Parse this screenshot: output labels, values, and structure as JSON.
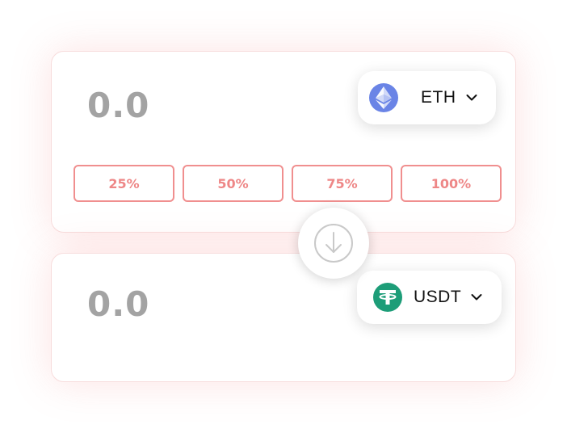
{
  "from": {
    "amount": "0.0",
    "token": {
      "symbol": "ETH",
      "icon": "ethereum-icon",
      "color": "#6a84e6"
    },
    "percent_buttons": [
      "25%",
      "50%",
      "75%",
      "100%"
    ]
  },
  "swap": {
    "icon": "arrow-down-icon"
  },
  "to": {
    "amount": "0.0",
    "token": {
      "symbol": "USDT",
      "icon": "tether-icon",
      "color": "#1d9d78"
    }
  },
  "colors": {
    "accent": "#f08f8f",
    "amount_text": "#a3a3a3"
  }
}
